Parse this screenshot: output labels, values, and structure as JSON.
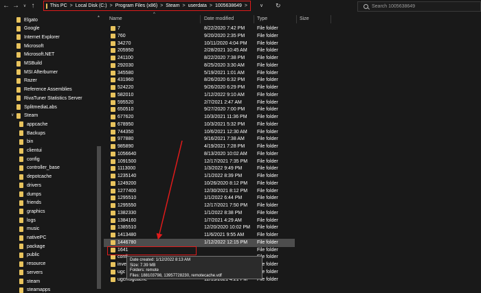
{
  "address_bar": {
    "crumbs": [
      "This PC",
      "Local Disk (C:)",
      "Program Files (x86)",
      "Steam",
      "userdata",
      "1005638649"
    ],
    "separator": ">"
  },
  "search": {
    "placeholder": "Search 1005638649"
  },
  "nav": {
    "back": "←",
    "forward": "→",
    "dropdown": "∨",
    "up": "↑",
    "refresh": "↻"
  },
  "columns": {
    "name": "Name",
    "date": "Date modified",
    "type": "Type",
    "size": "Size"
  },
  "tree": [
    {
      "label": "Elgato",
      "indent": 0
    },
    {
      "label": "Google",
      "indent": 0
    },
    {
      "label": "Internet Explorer",
      "indent": 0
    },
    {
      "label": "Microsoft",
      "indent": 0
    },
    {
      "label": "Microsoft.NET",
      "indent": 0
    },
    {
      "label": "MSBuild",
      "indent": 0
    },
    {
      "label": "MSI Afterburner",
      "indent": 0
    },
    {
      "label": "Razer",
      "indent": 0
    },
    {
      "label": "Reference Assemblies",
      "indent": 0
    },
    {
      "label": "RivaTuner Statistics Server",
      "indent": 0
    },
    {
      "label": "SplitmediaLabs",
      "indent": 0
    },
    {
      "label": "Steam",
      "indent": 0,
      "expanded": true
    },
    {
      "label": "appcache",
      "indent": 1
    },
    {
      "label": "Backups",
      "indent": 1
    },
    {
      "label": "bin",
      "indent": 1
    },
    {
      "label": "clientui",
      "indent": 1
    },
    {
      "label": "config",
      "indent": 1
    },
    {
      "label": "controller_base",
      "indent": 1
    },
    {
      "label": "depotcache",
      "indent": 1
    },
    {
      "label": "drivers",
      "indent": 1
    },
    {
      "label": "dumps",
      "indent": 1
    },
    {
      "label": "friends",
      "indent": 1
    },
    {
      "label": "graphics",
      "indent": 1
    },
    {
      "label": "logs",
      "indent": 1
    },
    {
      "label": "music",
      "indent": 1
    },
    {
      "label": "nativePC",
      "indent": 1
    },
    {
      "label": "package",
      "indent": 1
    },
    {
      "label": "public",
      "indent": 1
    },
    {
      "label": "resource",
      "indent": 1
    },
    {
      "label": "servers",
      "indent": 1
    },
    {
      "label": "steam",
      "indent": 1
    },
    {
      "label": "steamapps",
      "indent": 1
    }
  ],
  "files": [
    {
      "name": "7",
      "date": "8/22/2020 7:42 PM",
      "type": "File folder"
    },
    {
      "name": "760",
      "date": "9/20/2020 2:35 PM",
      "type": "File folder"
    },
    {
      "name": "34270",
      "date": "10/11/2020 4:04 PM",
      "type": "File folder"
    },
    {
      "name": "205950",
      "date": "2/28/2021 10:45 AM",
      "type": "File folder"
    },
    {
      "name": "241100",
      "date": "8/22/2020 7:38 PM",
      "type": "File folder"
    },
    {
      "name": "292030",
      "date": "8/25/2020 3:30 AM",
      "type": "File folder"
    },
    {
      "name": "345580",
      "date": "5/19/2021 1:01 AM",
      "type": "File folder"
    },
    {
      "name": "431960",
      "date": "8/26/2020 6:32 PM",
      "type": "File folder"
    },
    {
      "name": "524220",
      "date": "9/26/2020 6:29 PM",
      "type": "File folder"
    },
    {
      "name": "582010",
      "date": "1/12/2022 9:10 AM",
      "type": "File folder"
    },
    {
      "name": "595520",
      "date": "2/7/2021 2:47 AM",
      "type": "File folder"
    },
    {
      "name": "650510",
      "date": "9/27/2020 7:00 PM",
      "type": "File folder"
    },
    {
      "name": "677620",
      "date": "10/3/2021 11:36 PM",
      "type": "File folder"
    },
    {
      "name": "678950",
      "date": "10/3/2021 5:32 PM",
      "type": "File folder"
    },
    {
      "name": "744350",
      "date": "10/6/2021 12:30 AM",
      "type": "File folder"
    },
    {
      "name": "977880",
      "date": "9/16/2021 7:38 AM",
      "type": "File folder"
    },
    {
      "name": "985890",
      "date": "4/19/2021 7:28 PM",
      "type": "File folder"
    },
    {
      "name": "1056640",
      "date": "8/13/2020 10:02 AM",
      "type": "File folder"
    },
    {
      "name": "1091500",
      "date": "12/17/2021 7:35 PM",
      "type": "File folder"
    },
    {
      "name": "1113000",
      "date": "1/3/2022 9:49 PM",
      "type": "File folder"
    },
    {
      "name": "1235140",
      "date": "1/1/2022 8:39 PM",
      "type": "File folder"
    },
    {
      "name": "1249200",
      "date": "10/26/2020 8:12 PM",
      "type": "File folder"
    },
    {
      "name": "1277400",
      "date": "12/30/2021 8:12 PM",
      "type": "File folder"
    },
    {
      "name": "1295510",
      "date": "1/1/2022 6:44 PM",
      "type": "File folder"
    },
    {
      "name": "1295550",
      "date": "12/17/2021 7:50 PM",
      "type": "File folder"
    },
    {
      "name": "1382330",
      "date": "1/1/2022 8:38 PM",
      "type": "File folder"
    },
    {
      "name": "1384160",
      "date": "1/7/2021 4:29 AM",
      "type": "File folder"
    },
    {
      "name": "1385510",
      "date": "12/20/2020 10:02 PM",
      "type": "File folder"
    },
    {
      "name": "1413480",
      "date": "11/6/2021 9:55 AM",
      "type": "File folder"
    },
    {
      "name": "1446780",
      "date": "1/12/2022 12:15 PM",
      "type": "File folder",
      "selected": true
    },
    {
      "name": "1641",
      "date": "",
      "type": "File folder"
    },
    {
      "name": "confi",
      "date": "",
      "type": "File folder"
    },
    {
      "name": "inver",
      "date": "",
      "type": "File folder"
    },
    {
      "name": "ugc",
      "date": "1/1/2022 8:39 PM",
      "type": "File folder"
    },
    {
      "name": "ugcmsgcache",
      "date": "12/13/2021 4:21 PM",
      "type": "File folder"
    }
  ],
  "tooltip": {
    "created": "Date created: 1/12/2022 8:13 AM",
    "size": "Size: 7.39 MB",
    "folders": "Folders: remote",
    "files": "Files: 188103798, 13957728230, remotecache.vdf"
  },
  "colors": {
    "background": "#191919",
    "highlight_red": "#e11b1b",
    "folder_yellow": "#e8c35d",
    "selected_row": "#4d4d4d"
  }
}
